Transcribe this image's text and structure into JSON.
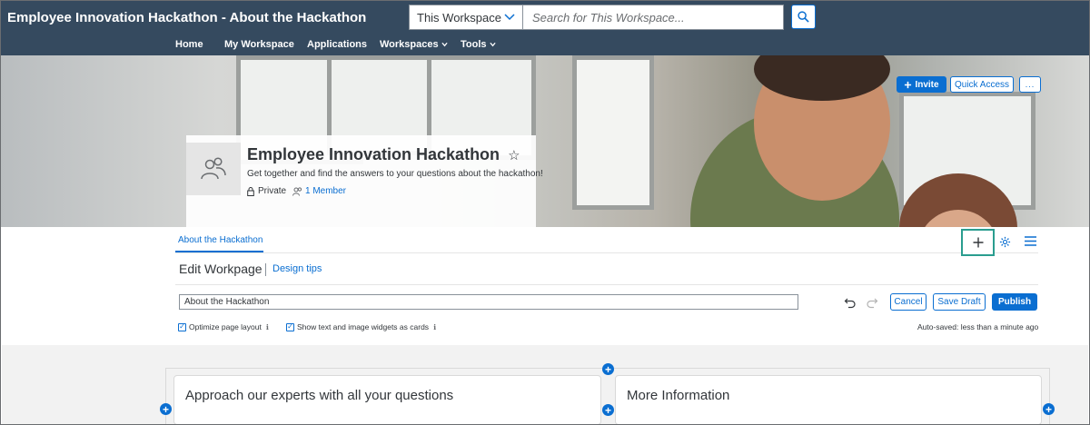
{
  "app": {
    "title": "Employee Innovation Hackathon - About the Hackathon"
  },
  "search": {
    "scope": "This Workspace",
    "placeholder": "Search for This Workspace..."
  },
  "nav": [
    {
      "label": "Home"
    },
    {
      "label": "My Workspace"
    },
    {
      "label": "Applications"
    },
    {
      "label": "Workspaces",
      "has_dropdown": true
    },
    {
      "label": "Tools",
      "has_dropdown": true
    }
  ],
  "header_actions": {
    "invite": "Invite",
    "quick_access": "Quick Access",
    "more": "..."
  },
  "workspace": {
    "name": "Employee Innovation Hackathon",
    "description": "Get together and find the answers to your questions about the hackathon!",
    "privacy": "Private",
    "members": "1 Member",
    "favorite": false
  },
  "tabs": [
    {
      "label": "About the Hackathon",
      "active": true
    }
  ],
  "editor": {
    "title": "Edit Workpage",
    "design_tips": "Design tips",
    "page_name": "About the Hackathon",
    "cancel": "Cancel",
    "save_draft": "Save Draft",
    "publish": "Publish",
    "option_optimize": "Optimize page layout",
    "option_cards": "Show text and image widgets as cards",
    "autosaved": "Auto-saved: less than a minute ago"
  },
  "widgets": [
    {
      "title": "Approach our experts with all your questions"
    },
    {
      "title": "More Information"
    }
  ],
  "colors": {
    "header": "#354a5f",
    "accent": "#0a6ed1",
    "highlight": "#2a9d8f"
  }
}
